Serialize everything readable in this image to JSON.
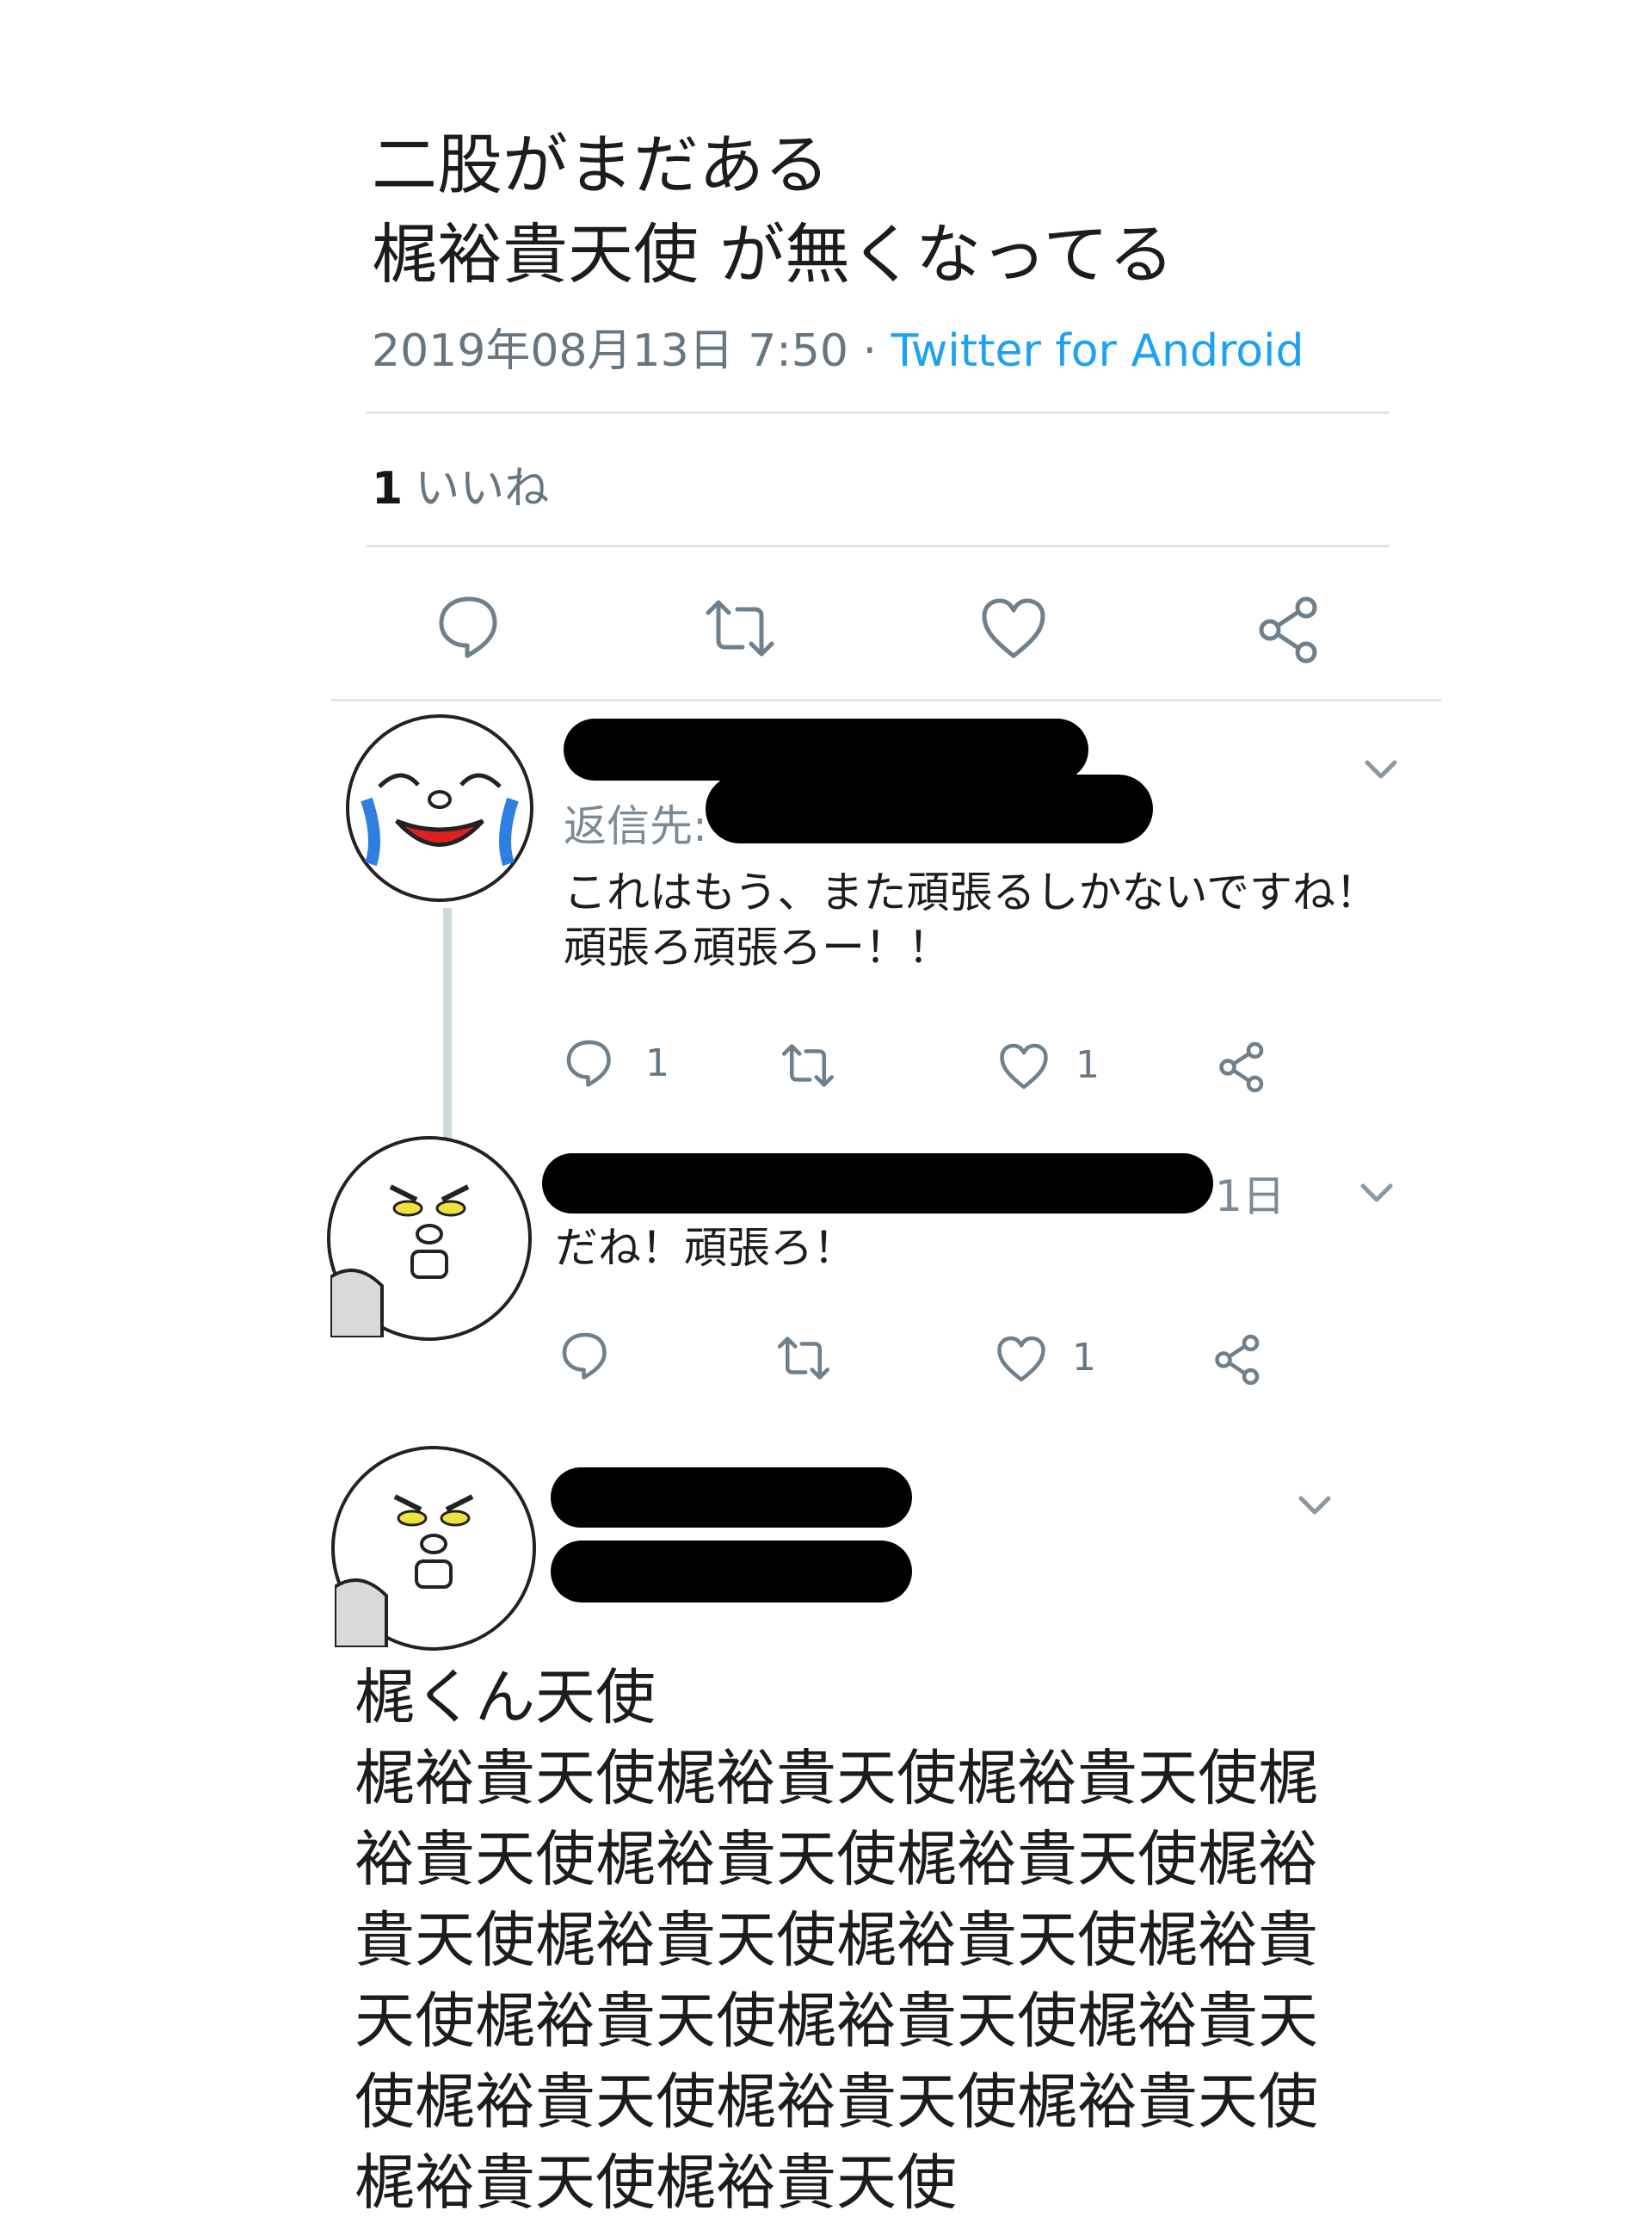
{
  "main_tweet": {
    "lines": [
      "二股がまだある",
      "梶裕貴天使  が無くなってる"
    ],
    "timestamp": "2019年08月13日 7:50",
    "separator": "·",
    "source": "Twitter for Android",
    "likes_count": "1",
    "likes_label": "いいね"
  },
  "reply1": {
    "reply_to_label": "返信先:",
    "lines": [
      "これはもう、また頑張るしかないですね！",
      "頑張ろ頑張ろー！！"
    ],
    "reply_count": "1",
    "like_count": "1"
  },
  "reply2": {
    "time": "1日",
    "text": "だね！頑張ろ！",
    "like_count": "1"
  },
  "tweet3": {
    "lines": [
      "梶くん天使",
      "梶裕貴天使梶裕貴天使梶裕貴天使梶",
      "裕貴天使梶裕貴天使梶裕貴天使梶裕",
      "貴天使梶裕貴天使梶裕貴天使梶裕貴",
      "天使梶裕貴天使梶裕貴天使梶裕貴天",
      "使梶裕貴天使梶裕貴天使梶裕貴天使",
      "梶裕貴天使梶裕貴天使"
    ]
  },
  "icons": {
    "reply": "reply-icon",
    "retweet": "retweet-icon",
    "like": "heart-icon",
    "share": "share-icon",
    "more": "chevron-down-icon"
  },
  "colors": {
    "link": "#1da1f2",
    "meta": "#66757f",
    "icon": "#6f7f8c",
    "redaction": "#000000"
  }
}
